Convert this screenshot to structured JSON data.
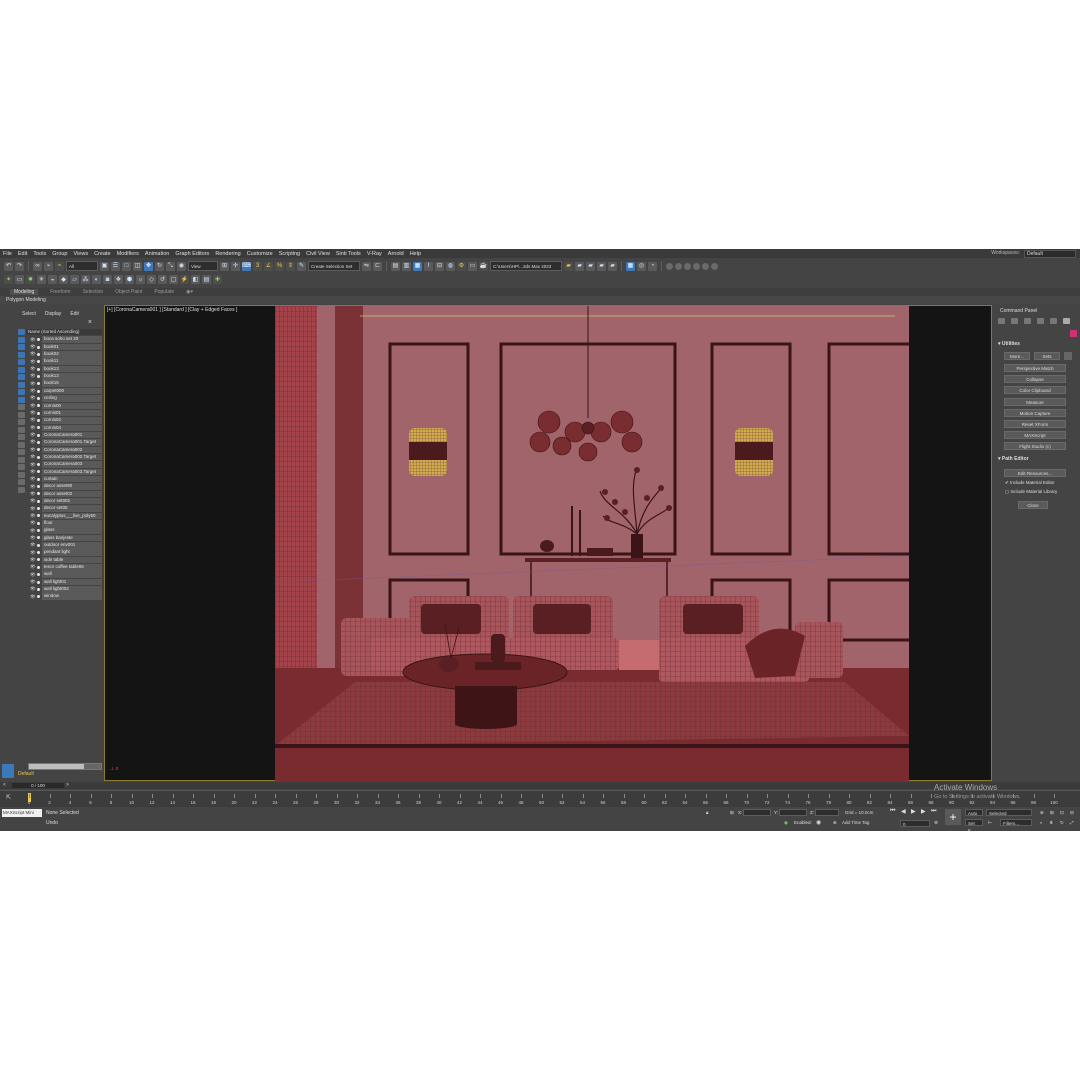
{
  "menu": [
    "File",
    "Edit",
    "Tools",
    "Group",
    "Views",
    "Create",
    "Modifiers",
    "Animation",
    "Graph Editors",
    "Rendering",
    "Customize",
    "Scripting",
    "Civil View",
    "Sinti Tools",
    "V-Ray",
    "Arnold",
    "Help"
  ],
  "workspace": {
    "label": "Workspaces:",
    "value": "Default"
  },
  "toolbar": {
    "filter_value": "All",
    "view_value": "View",
    "selection_set_placeholder": "Create Selection Set",
    "path_value": "C:\\Users\\HP\\...3ds Max 2023"
  },
  "ribbon": {
    "tabs": [
      {
        "label": "Modeling",
        "active": true
      },
      {
        "label": "Freeform",
        "active": false
      },
      {
        "label": "Selection",
        "active": false
      },
      {
        "label": "Object Paint",
        "active": false
      },
      {
        "label": "Populate",
        "active": false
      }
    ],
    "sub_label": "Polygon Modeling"
  },
  "explorer": {
    "tabs": [
      "Select",
      "Display",
      "Edit"
    ],
    "header": "Name (Sorted Ascending)",
    "items": [
      "boca soho set 20",
      "book01",
      "book02",
      "book11",
      "book13",
      "book13",
      "book15",
      "carpet000",
      "ceiling",
      "cornis00",
      "cornis01",
      "cornis02",
      "cornis04",
      "CoronaCamera001",
      "CoronaCamera001.Target",
      "CoronaCamera002",
      "CoronaCamera002.Target",
      "CoronaCamera003",
      "CoronaCamera003.Target",
      "curtain",
      "decor asset90",
      "decor asset02",
      "decor set002",
      "decor set05",
      "eucalyptus___live_poly50",
      "floor",
      "glass",
      "glass banjeste",
      "outdoor env001",
      "pendant light",
      "side table",
      "tenor coffee table06",
      "wall",
      "wall light01",
      "wall light002",
      "window"
    ],
    "layer": "Default"
  },
  "viewport": {
    "label": "[+] [CoronaCamera001 ] [Standard ] [Clay + Edged Faces ]"
  },
  "command_panel": {
    "title": "Command Panel",
    "utilities_title": "Utilities",
    "more_label": "More...",
    "sets_label": "Sets",
    "utility_buttons": [
      "Perspective Match",
      "Collapse",
      "Color Clipboard",
      "Measure",
      "Motion Capture",
      "Reset XForm",
      "MAXScript",
      "Flight Studio (c)"
    ],
    "path_editor_title": "Path Editor",
    "edit_resources_label": "Edit Resources...",
    "include_material_editor": "Include Material Editor",
    "include_material_library": "Include Material Library",
    "close_label": "Close",
    "colors": {
      "accent": "#d12f79"
    }
  },
  "timeline": {
    "frame": "0 / 100",
    "ticks": [
      "0",
      "2",
      "4",
      "6",
      "8",
      "10",
      "12",
      "14",
      "16",
      "18",
      "20",
      "22",
      "24",
      "26",
      "28",
      "30",
      "32",
      "34",
      "36",
      "38",
      "40",
      "42",
      "44",
      "46",
      "48",
      "50",
      "52",
      "54",
      "56",
      "58",
      "60",
      "62",
      "64",
      "66",
      "68",
      "70",
      "72",
      "74",
      "76",
      "78",
      "80",
      "82",
      "84",
      "86",
      "88",
      "90",
      "92",
      "94",
      "96",
      "98",
      "100"
    ]
  },
  "status": {
    "script_text": "MAXScript Mini",
    "selection": "None Selected",
    "undo": "Undo",
    "x_label": "X:",
    "y_label": "Y:",
    "z_label": "Z:",
    "grid": "Grid = 10.0cm",
    "enabled": "Enabled:",
    "add_time_tag": "Add Time Tag",
    "auto": "Auto",
    "selected": "Selected",
    "set_k": "Set K.",
    "filters": "Filters..."
  },
  "watermark": {
    "line1": "Activate Windows",
    "line2": "Go to Settings to activate Windows."
  }
}
